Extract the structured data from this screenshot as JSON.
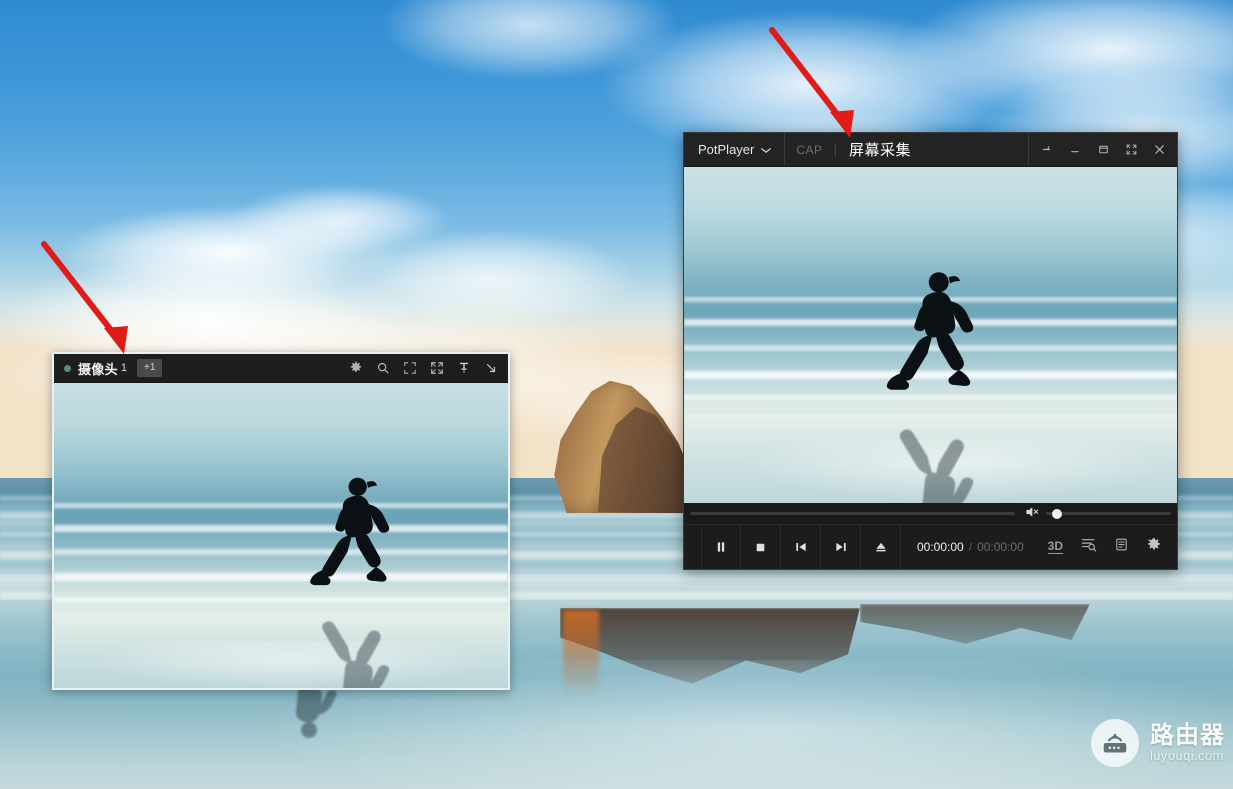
{
  "desktop": {
    "wallpaper_description": "Beach at sunset with runner silhouette, rock formation and reflective wet sand",
    "sky_color": "#3e97d8",
    "sand_color": "#8ebbc8"
  },
  "annotations": {
    "arrow_color": "#e01b18",
    "arrows": [
      {
        "name": "arrow-to-camera-window"
      },
      {
        "name": "arrow-to-potplayer-title"
      }
    ]
  },
  "camera_window": {
    "status_dot_color": "#5a8a86",
    "title": "摄像头",
    "index": "1",
    "badge": "+1",
    "icons": [
      {
        "name": "gear-icon",
        "label": "设置"
      },
      {
        "name": "search-icon",
        "label": "搜索"
      },
      {
        "name": "fit-icon",
        "label": "适应窗口"
      },
      {
        "name": "fullscreen-icon",
        "label": "全屏"
      },
      {
        "name": "pin-icon",
        "label": "置顶"
      },
      {
        "name": "minimize-corner-icon",
        "label": "最小化"
      }
    ],
    "video_description": "Runner silhouette on beach"
  },
  "potplayer": {
    "brand": "PotPlayer",
    "chevron": "⌄",
    "cap_label": "CAP",
    "separator": "|",
    "document_title": "屏幕采集",
    "window_buttons": [
      {
        "name": "pin-icon",
        "label": "置顶"
      },
      {
        "name": "minimize-icon",
        "label": "最小化"
      },
      {
        "name": "restore-icon",
        "label": "还原"
      },
      {
        "name": "fullscreen-icon",
        "label": "全屏"
      },
      {
        "name": "close-icon",
        "label": "关闭"
      }
    ],
    "seek": {
      "value": 0,
      "max": 100
    },
    "volume": {
      "value": 8,
      "max": 100,
      "muted": true
    },
    "transport": [
      {
        "name": "pause-button",
        "label": "暂停"
      },
      {
        "name": "stop-button",
        "label": "停止"
      },
      {
        "name": "previous-button",
        "label": "上一个"
      },
      {
        "name": "next-button",
        "label": "下一个"
      },
      {
        "name": "eject-button",
        "label": "弹出"
      }
    ],
    "time": {
      "current": "00:00:00",
      "separator": "/",
      "total": "00:00:00"
    },
    "right_icons": [
      {
        "name": "3d-icon",
        "label": "3D"
      },
      {
        "name": "playlist-search-icon",
        "label": "播放列表搜索"
      },
      {
        "name": "playlist-icon",
        "label": "播放列表"
      },
      {
        "name": "settings-gear-icon",
        "label": "设置"
      }
    ],
    "video_description": "Runner silhouette on beach with reflection"
  },
  "watermark": {
    "icon_name": "router-icon",
    "title": "路由器",
    "domain": "luyouqi.com"
  }
}
